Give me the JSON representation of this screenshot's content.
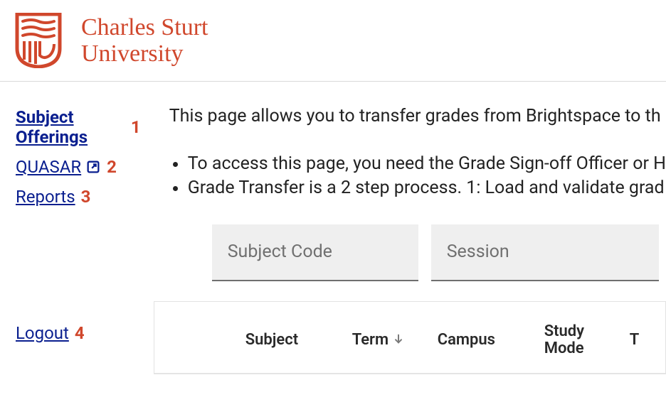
{
  "brand": {
    "line1": "Charles Sturt",
    "line2": "University",
    "color": "#d0472c"
  },
  "sidebar": {
    "items": [
      {
        "label": "Subject Offerings",
        "annot": "1",
        "active": true
      },
      {
        "label": "QUASAR",
        "annot": "2",
        "external": true
      },
      {
        "label": "Reports",
        "annot": "3"
      }
    ],
    "logout": {
      "label": "Logout",
      "annot": "4"
    }
  },
  "main": {
    "intro": "This page allows you to transfer grades from Brightspace to th",
    "bullets": [
      "To access this page, you need the Grade Sign-off Officer or H",
      "Grade Transfer is a 2 step process. 1: Load and validate grad"
    ],
    "filters": {
      "subject_code": {
        "placeholder": "Subject Code",
        "value": ""
      },
      "session": {
        "placeholder": "Session",
        "value": ""
      }
    },
    "table": {
      "columns": [
        {
          "label": "Subject"
        },
        {
          "label": "Term",
          "sort": "desc"
        },
        {
          "label": "Campus"
        },
        {
          "label": "Study Mode"
        },
        {
          "label": "T"
        }
      ],
      "rows": []
    }
  }
}
